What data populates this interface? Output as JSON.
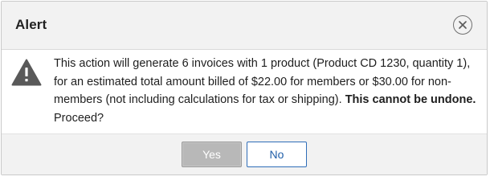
{
  "dialog": {
    "title": "Alert",
    "close_icon": "close-icon",
    "warning_icon": "warning-triangle-icon",
    "message": "This action will generate 6 invoices with 1 product (Product CD 1230, quantity 1), for an estimated total amount billed of $22.00 for members or $30.00 for non-members (not including calculations for tax or shipping).",
    "emphasis": "This cannot be undone.",
    "question": " Proceed?",
    "buttons": {
      "yes_label": "Yes",
      "no_label": "No"
    }
  },
  "colors": {
    "header_bg": "#f2f2f2",
    "yes_button_bg": "#b8b8b8",
    "no_button_border": "#2f6db8",
    "no_button_text": "#1f5ea8",
    "warning_icon": "#595959"
  }
}
